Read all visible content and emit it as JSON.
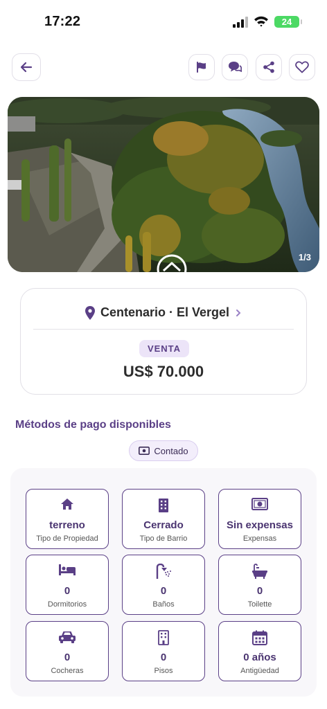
{
  "status": {
    "time": "17:22",
    "battery": "24"
  },
  "nav": {
    "back_icon": "arrow-left-icon",
    "actions": [
      "flag-icon",
      "chat-icon",
      "share-icon",
      "heart-icon"
    ]
  },
  "gallery": {
    "counter": "1/3"
  },
  "listing": {
    "location": "Centenario · El Vergel",
    "operation": "VENTA",
    "price": "US$ 70.000"
  },
  "payment": {
    "title": "Métodos de pago disponibles",
    "methods": [
      {
        "label": "Contado",
        "icon": "cash-icon"
      }
    ]
  },
  "features": [
    {
      "value": "terreno",
      "label": "Tipo de Propiedad",
      "icon": "house-icon"
    },
    {
      "value": "Cerrado",
      "label": "Tipo de Barrio",
      "icon": "building-icon"
    },
    {
      "value": "Sin expensas",
      "label": "Expensas",
      "icon": "cash-icon"
    },
    {
      "value": "0",
      "label": "Dormitorios",
      "icon": "bed-icon"
    },
    {
      "value": "0",
      "label": "Baños",
      "icon": "shower-icon"
    },
    {
      "value": "0",
      "label": "Toilette",
      "icon": "bathtub-icon"
    },
    {
      "value": "0",
      "label": "Cocheras",
      "icon": "car-icon"
    },
    {
      "value": "0",
      "label": "Pisos",
      "icon": "floors-icon"
    },
    {
      "value": "0 años",
      "label": "Antigüedad",
      "icon": "calendar-icon"
    }
  ],
  "colors": {
    "accent": "#5a3f86",
    "badge_bg": "#ece4f8",
    "battery": "#4cd964"
  }
}
